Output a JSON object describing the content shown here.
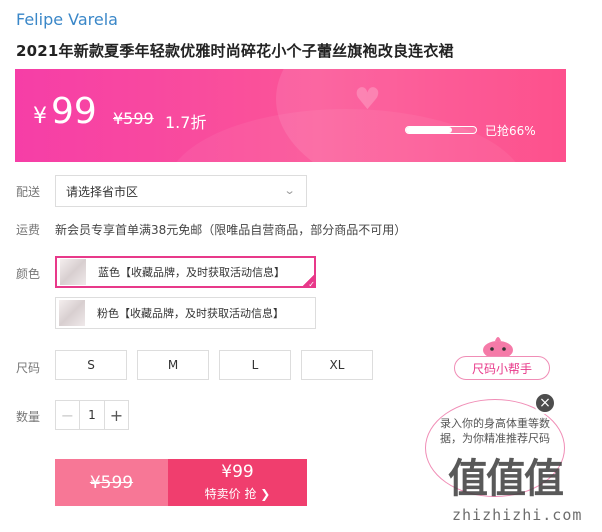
{
  "brand": "Felipe Varela",
  "product_title": "2021年新款夏季年轻款优雅时尚碎花小个子蕾丝旗袍改良连衣裙",
  "price": {
    "symbol": "¥",
    "current": "99",
    "original": "¥599",
    "discount": "1.7折",
    "sold_text": "已抢66%",
    "sold_fraction": 0.66,
    "accent": "#f63ea7"
  },
  "delivery": {
    "label": "配送",
    "placeholder": "请选择省市区"
  },
  "shipping": {
    "label": "运费",
    "text": "新会员专享首单满38元免邮（限唯品自营商品，部分商品不可用）"
  },
  "colors": {
    "label": "颜色",
    "options": [
      {
        "name": "蓝色【收藏品牌，及时获取活动信息】",
        "selected": true
      },
      {
        "name": "粉色【收藏品牌，及时获取活动信息】",
        "selected": false
      }
    ]
  },
  "sizes": {
    "label": "尺码",
    "options": [
      "S",
      "M",
      "L",
      "XL"
    ]
  },
  "quantity": {
    "label": "数量",
    "value": "1",
    "minus": "−",
    "plus": "+"
  },
  "buy": {
    "original_price": "¥599",
    "sale_price": "¥99",
    "cta": "特卖价 抢 ❯"
  },
  "helper": {
    "title": "尺码小帮手",
    "bubble_text": "录入你的身高体重等数据，为你精准推荐尺码",
    "close": "×"
  },
  "watermark": {
    "logo": "值值值",
    "text": "zhizhizhi.com"
  }
}
